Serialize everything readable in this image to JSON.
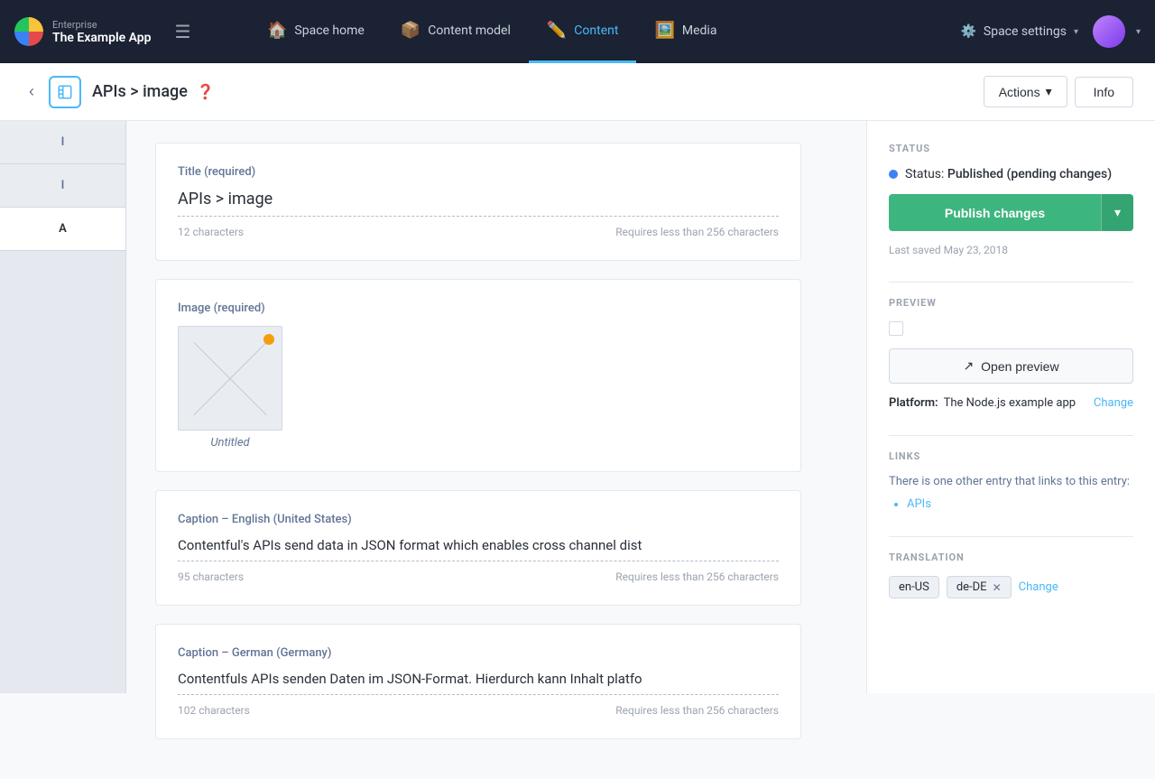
{
  "brand": {
    "enterprise_label": "Enterprise",
    "app_name": "The Example App"
  },
  "nav": {
    "hamburger_label": "☰",
    "items": [
      {
        "id": "space-home",
        "label": "Space home",
        "icon": "🏠",
        "active": false
      },
      {
        "id": "content-model",
        "label": "Content model",
        "icon": "📦",
        "active": false
      },
      {
        "id": "content",
        "label": "Content",
        "icon": "✏️",
        "active": true
      },
      {
        "id": "media",
        "label": "Media",
        "icon": "🖼️",
        "active": false
      }
    ],
    "space_settings": {
      "label": "Space settings",
      "icon": "⚙️"
    }
  },
  "entry_header": {
    "back_label": "‹",
    "title": "APIs > image",
    "help_icon": "?",
    "actions_label": "Actions",
    "info_label": "Info"
  },
  "left_sidebar": {
    "tabs": [
      {
        "id": "tab1",
        "label": "I",
        "active": false
      },
      {
        "id": "tab2",
        "label": "I",
        "active": false
      },
      {
        "id": "tab3",
        "label": "A",
        "active": false
      }
    ]
  },
  "form": {
    "title_field": {
      "label": "Title (required)",
      "value": "APIs > image",
      "char_count": "12 characters",
      "char_limit": "Requires less than 256 characters"
    },
    "image_field": {
      "label": "Image (required)",
      "thumb_caption": "Untitled"
    },
    "caption_english": {
      "label": "Caption – English (United States)",
      "value": "Contentful's APIs send data in JSON format which enables cross channel dist",
      "char_count": "95 characters",
      "char_limit": "Requires less than 256 characters"
    },
    "caption_german": {
      "label": "Caption – German (Germany)",
      "value": "Contentfuls APIs senden Daten im JSON-Format. Hierdurch kann Inhalt platfo",
      "char_count": "102 characters",
      "char_limit": "Requires less than 256 characters"
    }
  },
  "right_panel": {
    "status_section": {
      "title": "STATUS",
      "status_label": "Status: ",
      "status_value": "Published (pending changes)"
    },
    "publish_btn_label": "Publish changes",
    "last_saved": "Last saved May 23, 2018",
    "preview_section": {
      "title": "PREVIEW"
    },
    "open_preview_label": "Open preview",
    "platform_section": {
      "platform_label": "Platform:",
      "platform_value": "The Node.js example app",
      "change_label": "Change"
    },
    "links_section": {
      "title": "LINKS",
      "description": "There is one other entry that links to this entry:",
      "items": [
        "APIs"
      ]
    },
    "translation_section": {
      "title": "TRANSLATION",
      "tags": [
        {
          "id": "en-US",
          "label": "en-US",
          "has_close": false
        },
        {
          "id": "de-DE",
          "label": "de-DE",
          "has_close": true
        }
      ],
      "change_label": "Change"
    }
  }
}
